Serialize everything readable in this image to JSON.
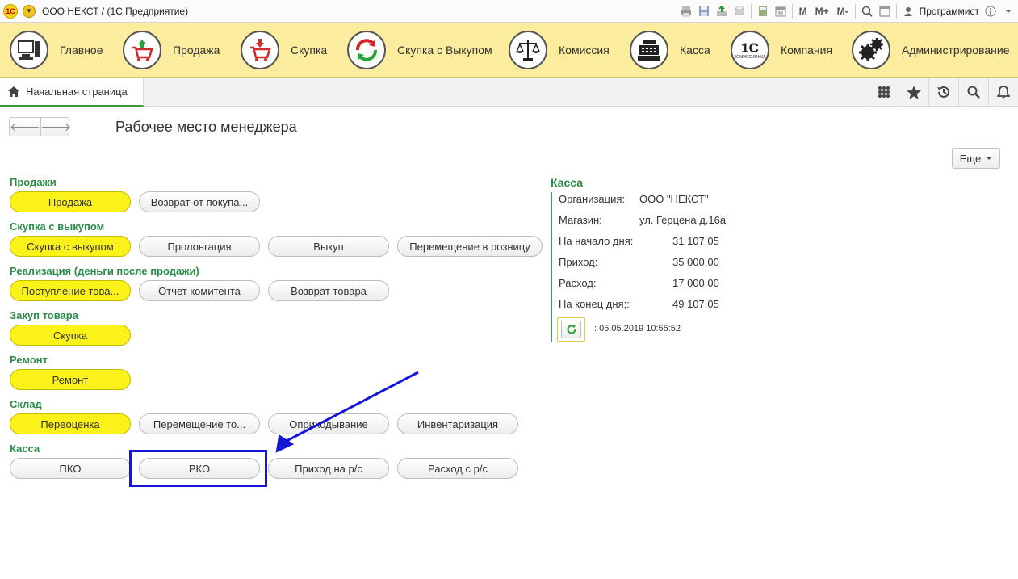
{
  "titlebar": {
    "title": "ООО НЕКСТ /   (1С:Предприятие)",
    "logo": "1С",
    "tools": [
      "print-icon",
      "save-icon",
      "export-icon",
      "preview-icon",
      "calculator-icon",
      "calendar-icon"
    ],
    "memory": [
      "M",
      "M+",
      "M-"
    ],
    "user": "Программист"
  },
  "sections": [
    {
      "label": "Главное",
      "icon": "computer-icon"
    },
    {
      "label": "Продажа",
      "icon": "cart-up-icon"
    },
    {
      "label": "Скупка",
      "icon": "cart-down-icon"
    },
    {
      "label": "Скупка с Выкупом",
      "icon": "cycle-arrows-icon"
    },
    {
      "label": "Комиссия",
      "icon": "scales-icon"
    },
    {
      "label": "Касса",
      "icon": "cash-register-icon"
    },
    {
      "label": "Компания",
      "icon": "company-1c-icon"
    },
    {
      "label": "Администрирование",
      "icon": "gears-icon"
    }
  ],
  "company_icon_text": "1С",
  "company_icon_sub": "КОМИССИОНКА",
  "tabs": {
    "home": "Начальная страница"
  },
  "page": {
    "title": "Рабочее место менеджера",
    "more": "Еще"
  },
  "groups": [
    {
      "title": "Продажи",
      "buttons": [
        {
          "label": "Продажа",
          "hl": true
        },
        {
          "label": "Возврат от покупа...",
          "hl": false
        }
      ]
    },
    {
      "title": "Скупка с выкупом",
      "buttons": [
        {
          "label": "Скупка с выкупом",
          "hl": true
        },
        {
          "label": "Пролонгация",
          "hl": false
        },
        {
          "label": "Выкуп",
          "hl": false
        },
        {
          "label": "Перемещение в розницу",
          "hl": false
        }
      ]
    },
    {
      "title": "Реализация (деньги после продажи)",
      "buttons": [
        {
          "label": "Поступление това...",
          "hl": true
        },
        {
          "label": "Отчет комитента",
          "hl": false
        },
        {
          "label": "Возврат товара",
          "hl": false
        }
      ]
    },
    {
      "title": "Закуп товара",
      "buttons": [
        {
          "label": "Скупка",
          "hl": true
        }
      ]
    },
    {
      "title": "Ремонт",
      "buttons": [
        {
          "label": "Ремонт",
          "hl": true
        }
      ]
    },
    {
      "title": "Склад",
      "buttons": [
        {
          "label": "Переоценка",
          "hl": true
        },
        {
          "label": "Перемещение то...",
          "hl": false
        },
        {
          "label": "Оприходывание",
          "hl": false
        },
        {
          "label": "Инвентаризация",
          "hl": false
        }
      ]
    },
    {
      "title": "Касса",
      "buttons": [
        {
          "label": "ПКО",
          "hl": false
        },
        {
          "label": "РКО",
          "hl": false
        },
        {
          "label": "Приход на р/с",
          "hl": false
        },
        {
          "label": "Расход с р/с",
          "hl": false
        }
      ]
    }
  ],
  "kassa": {
    "title": "Касса",
    "rows": [
      {
        "label": "Организация:",
        "value": "ООО \"НЕКСТ\""
      },
      {
        "label": "Магазин:",
        "value": "ул. Герцена д.16а"
      },
      {
        "label": "На начало дня:",
        "value": "31 107,05"
      },
      {
        "label": "Приход:",
        "value": "35 000,00"
      },
      {
        "label": "Расход:",
        "value": "17 000,00"
      },
      {
        "label": "На конец дня;:",
        "value": "49 107,05"
      }
    ],
    "stamp": ":  05.05.2019 10:55:52"
  },
  "colors": {
    "accent_green": "#2a8c49",
    "highlight_yellow": "#fbf21a",
    "panel_yellow": "#fbec9e",
    "annotation_blue": "#1515d8"
  }
}
